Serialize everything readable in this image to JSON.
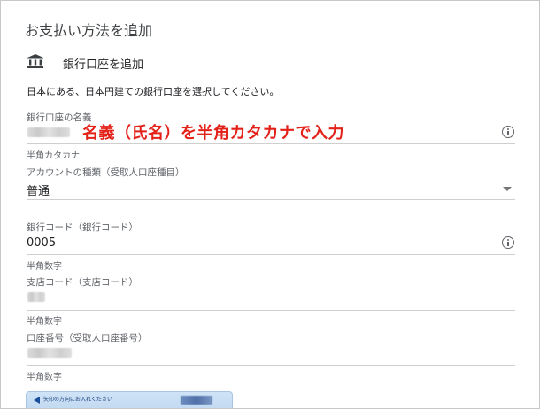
{
  "dialog": {
    "title": "お支払い方法を追加",
    "bank_option_label": "銀行口座を追加",
    "instruction": "日本にある、日本円建ての銀行口座を選択してください。"
  },
  "fields": {
    "account_name": {
      "label": "銀行口座の名義",
      "helper": "半角カタカナ"
    },
    "account_type": {
      "label": "アカウントの種類（受取人口座種目）",
      "value": "普通"
    },
    "bank_code": {
      "label": "銀行コード（銀行コード）",
      "value": "0005",
      "helper": "半角数字"
    },
    "branch_code": {
      "label": "支店コード（支店コード）",
      "helper": "半角数字"
    },
    "account_number": {
      "label": "口座番号（受取人口座番号）",
      "helper": "半角数字"
    }
  },
  "annotation": {
    "text": "名義（氏名）を半角カタカナで入力",
    "color": "#e32119"
  },
  "card": {
    "text": "矢印の方向にお入れください"
  },
  "icons": {
    "bank": "bank-icon",
    "info": "info-icon",
    "dropdown": "triangle-down-icon"
  }
}
